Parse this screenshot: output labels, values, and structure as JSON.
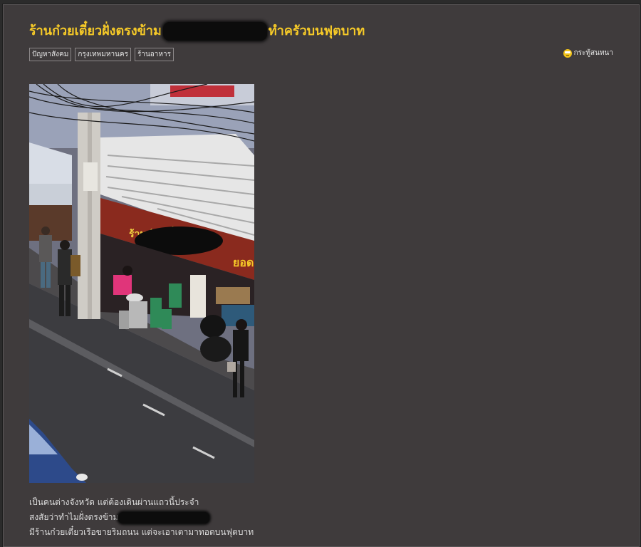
{
  "post": {
    "title_part1": "ร้านก๋วยเตี๋ยวฝั่งตรงข้าม",
    "title_part2": "ทำครัวบนฟุตบาท"
  },
  "tags": [
    "ปัญหาสังคม",
    "กรุงเทพมหานคร",
    "ร้านอาหาร"
  ],
  "room": {
    "label": "กระทู้สนทนา",
    "icon": "confounded-face-icon"
  },
  "photo": {
    "sign_text": "ร้านก๋วยเตี๋ยว",
    "banner_text": "ยอด"
  },
  "body": {
    "line1": "เป็นคนต่างจังหวัด แต่ต้องเดินผ่านแถวนี้ประจำ",
    "line2_prefix": "สงสัยว่าทำไมฝั่งตรงข้าม",
    "line3": "มีร้านก๋วยเตี๋ยวเรือขายริมถนน แต่จะเอาเตามาทอดบนฟุตบาท"
  },
  "colors": {
    "title": "#f5c928",
    "background": "#3f3b3c",
    "text": "#dcdcdc"
  }
}
